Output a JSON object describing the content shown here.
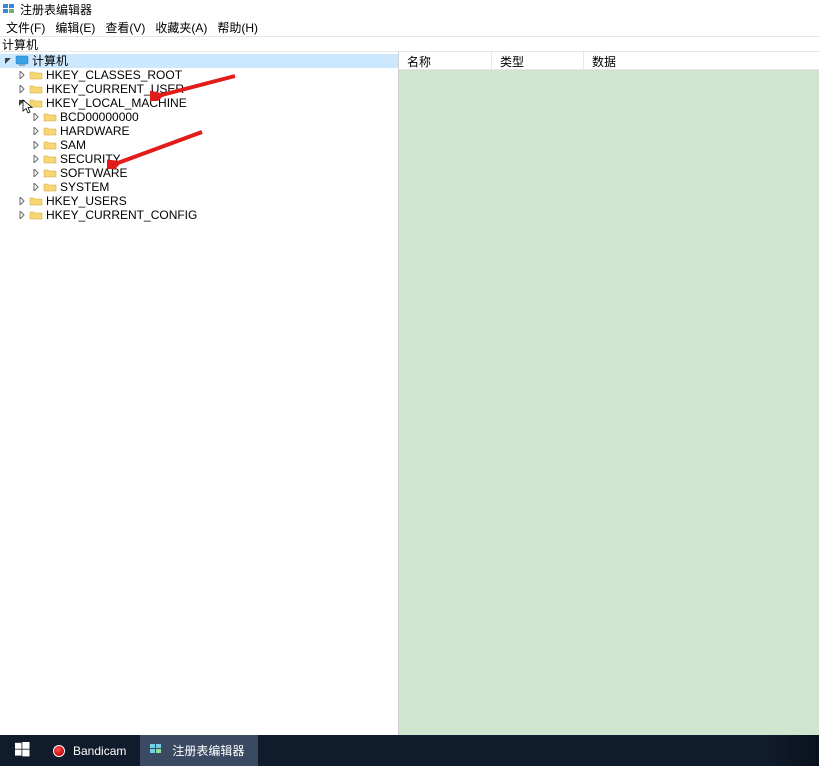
{
  "window": {
    "title": "注册表编辑器"
  },
  "menu": {
    "file": "文件(F)",
    "edit": "编辑(E)",
    "view": "查看(V)",
    "favorites": "收藏夹(A)",
    "help": "帮助(H)"
  },
  "address": {
    "path": "计算机"
  },
  "tree": {
    "root": "计算机",
    "hives": {
      "classes_root": "HKEY_CLASSES_ROOT",
      "current_user": "HKEY_CURRENT_USER",
      "local_machine": "HKEY_LOCAL_MACHINE",
      "users": "HKEY_USERS",
      "current_config": "HKEY_CURRENT_CONFIG"
    },
    "local_machine_children": {
      "bcd": "BCD00000000",
      "hardware": "HARDWARE",
      "sam": "SAM",
      "security": "SECURITY",
      "software": "SOFTWARE",
      "system": "SYSTEM"
    }
  },
  "list": {
    "columns": {
      "name": "名称",
      "type": "类型",
      "data": "数据"
    }
  },
  "taskbar": {
    "bandicam": "Bandicam",
    "regedit": "注册表编辑器"
  }
}
